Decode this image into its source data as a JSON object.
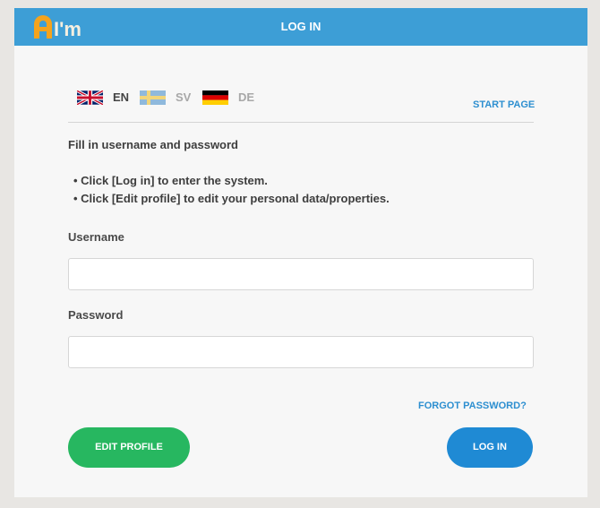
{
  "header": {
    "logo_text": "I'm",
    "title": "LOG IN"
  },
  "languages": [
    {
      "code": "EN",
      "flag": "uk-flag-icon",
      "active": true
    },
    {
      "code": "SV",
      "flag": "sweden-flag-icon",
      "active": false
    },
    {
      "code": "DE",
      "flag": "germany-flag-icon",
      "active": false
    }
  ],
  "start_page_label": "START PAGE",
  "intro": "Fill in username and password",
  "bullets": [
    "• Click [Log in] to enter the system.",
    "• Click [Edit profile] to edit your personal data/properties."
  ],
  "form": {
    "username_label": "Username",
    "username_value": "",
    "password_label": "Password",
    "password_value": ""
  },
  "forgot_password_label": "FORGOT PASSWORD?",
  "buttons": {
    "edit_profile": "EDIT PROFILE",
    "log_in": "LOG IN"
  },
  "colors": {
    "header": "#3d9ed6",
    "link": "#2d8fd0",
    "edit_button": "#27b760",
    "login_button": "#1f8ad4",
    "logo_orange": "#f4a31d"
  }
}
